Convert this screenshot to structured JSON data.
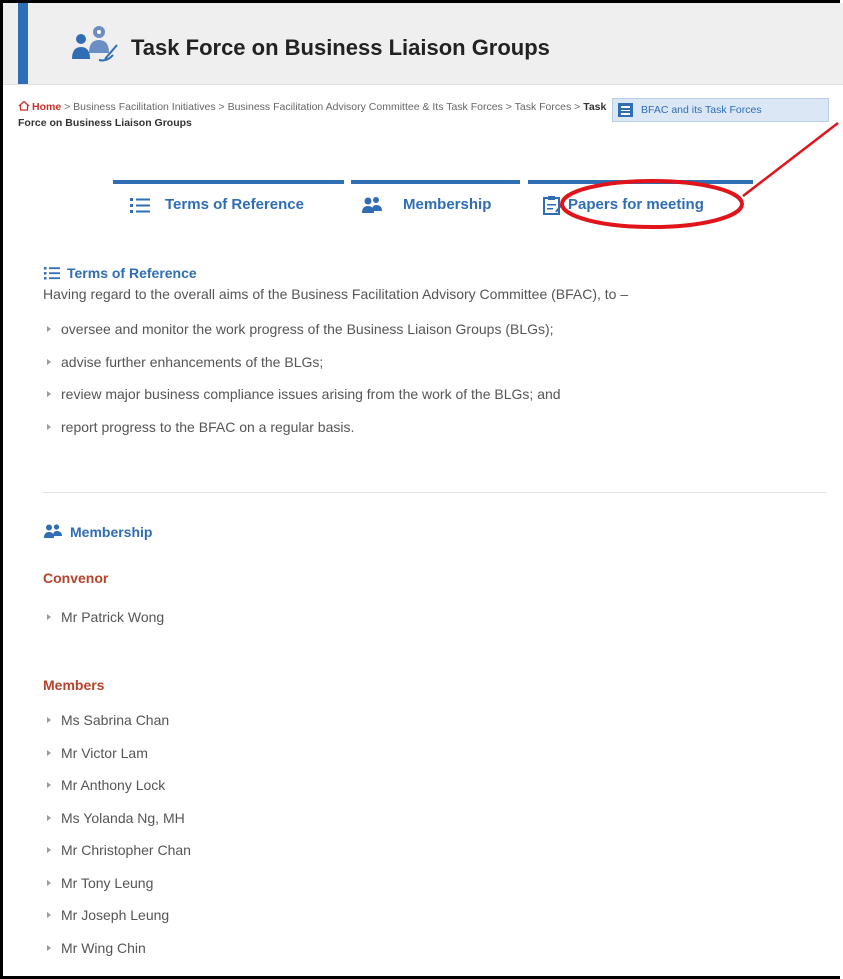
{
  "header": {
    "title": "Task Force on Business Liaison Groups"
  },
  "breadcrumb": {
    "home": "Home",
    "sep": ">",
    "items": [
      "Business Facilitation Initiatives",
      "Business Facilitation Advisory Committee & Its Task Forces",
      "Task Forces"
    ],
    "current": "Task Force on Business Liaison Groups"
  },
  "bfac_button": {
    "label": "BFAC and its Task Forces"
  },
  "tabs": [
    {
      "label": "Terms of Reference"
    },
    {
      "label": "Membership"
    },
    {
      "label": "Papers for meeting"
    }
  ],
  "terms": {
    "heading": "Terms of Reference",
    "intro": "Having regard to the overall aims of the Business Facilitation Advisory Committee (BFAC), to –",
    "items": [
      "oversee and monitor the work progress of the Business Liaison Groups (BLGs);",
      "advise further enhancements of the BLGs;",
      "review major business compliance issues arising from the work of the BLGs; and",
      "report progress to the BFAC on a regular basis."
    ]
  },
  "membership": {
    "heading": "Membership",
    "convenor_label": "Convenor",
    "convenor": [
      "Mr Patrick Wong"
    ],
    "members_label": "Members",
    "members": [
      "Ms Sabrina Chan",
      "Mr Victor Lam",
      "Mr Anthony Lock",
      "Ms Yolanda Ng, MH",
      "Mr Christopher Chan",
      "Mr Tony Leung",
      "Mr Joseph Leung",
      "Mr Wing Chin"
    ]
  },
  "colors": {
    "accent": "#2f6db5",
    "annotation": "#e0141a",
    "subhead": "#b8432b"
  }
}
